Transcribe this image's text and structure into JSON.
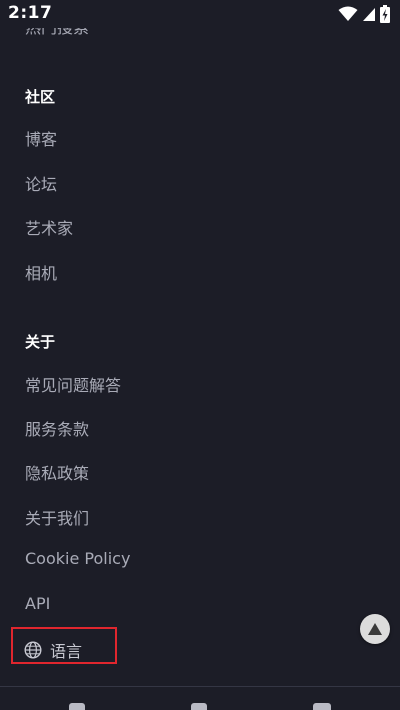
{
  "status_bar": {
    "time": "2:17",
    "icons": [
      "wifi-icon",
      "signal-icon",
      "battery-charging-icon"
    ]
  },
  "colors": {
    "background": "#1c1d27",
    "heading": "#ffffff",
    "link": "#a9abb7",
    "highlight_border": "#e0262e",
    "scroll_button": "#dcdcdc"
  },
  "partial_top_link": "热门搜索",
  "community": {
    "heading": "社区",
    "links": [
      "博客",
      "论坛",
      "艺术家",
      "相机"
    ]
  },
  "about": {
    "heading": "关于",
    "links": [
      "常见问题解答",
      "服务条款",
      "隐私政策",
      "关于我们",
      "Cookie Policy",
      "API"
    ]
  },
  "language": {
    "icon": "globe-icon",
    "label": "语言"
  },
  "scroll_top_icon": "arrow-up-icon",
  "footer_social_icons": [
    "facebook-icon",
    "instagram-icon",
    "twitter-icon"
  ]
}
